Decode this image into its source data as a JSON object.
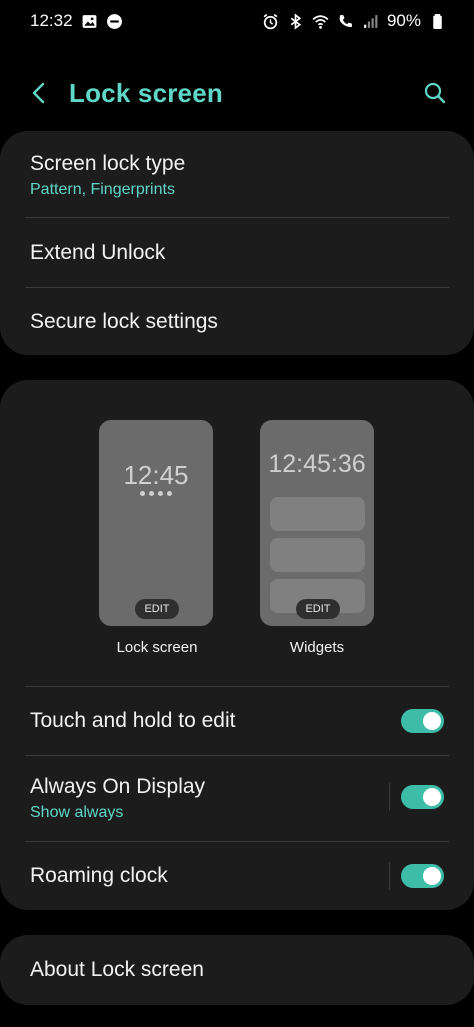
{
  "status_bar": {
    "time": "12:32",
    "battery": "90%",
    "left_icons": [
      "image-icon",
      "dnd-icon"
    ],
    "right_icons": [
      "alarm-icon",
      "bluetooth-icon",
      "wifi-icon",
      "wifi-call-icon",
      "signal-icon",
      "battery-icon"
    ]
  },
  "header": {
    "title": "Lock screen",
    "back_icon": "back-chevron-icon",
    "search_icon": "search-icon"
  },
  "security_group": {
    "screen_lock_type": {
      "label": "Screen lock type",
      "value": "Pattern, Fingerprints"
    },
    "extend_unlock": {
      "label": "Extend Unlock"
    },
    "secure_lock_settings": {
      "label": "Secure lock settings"
    }
  },
  "previews": {
    "lock": {
      "clock": "12:45",
      "edit_label": "EDIT",
      "label": "Lock screen"
    },
    "widgets": {
      "clock": "12:45:36",
      "edit_label": "EDIT",
      "label": "Widgets"
    }
  },
  "settings": {
    "touch_hold": {
      "label": "Touch and hold to edit",
      "enabled": true
    },
    "aod": {
      "label": "Always On Display",
      "sub": "Show always",
      "enabled": true
    },
    "roaming_clock": {
      "label": "Roaming clock",
      "enabled": true
    }
  },
  "about": {
    "label": "About Lock screen"
  },
  "colors": {
    "accent": "#5ed7c8",
    "toggle_on": "#3dbca8",
    "card": "#1c1c1c",
    "background": "#000000"
  }
}
